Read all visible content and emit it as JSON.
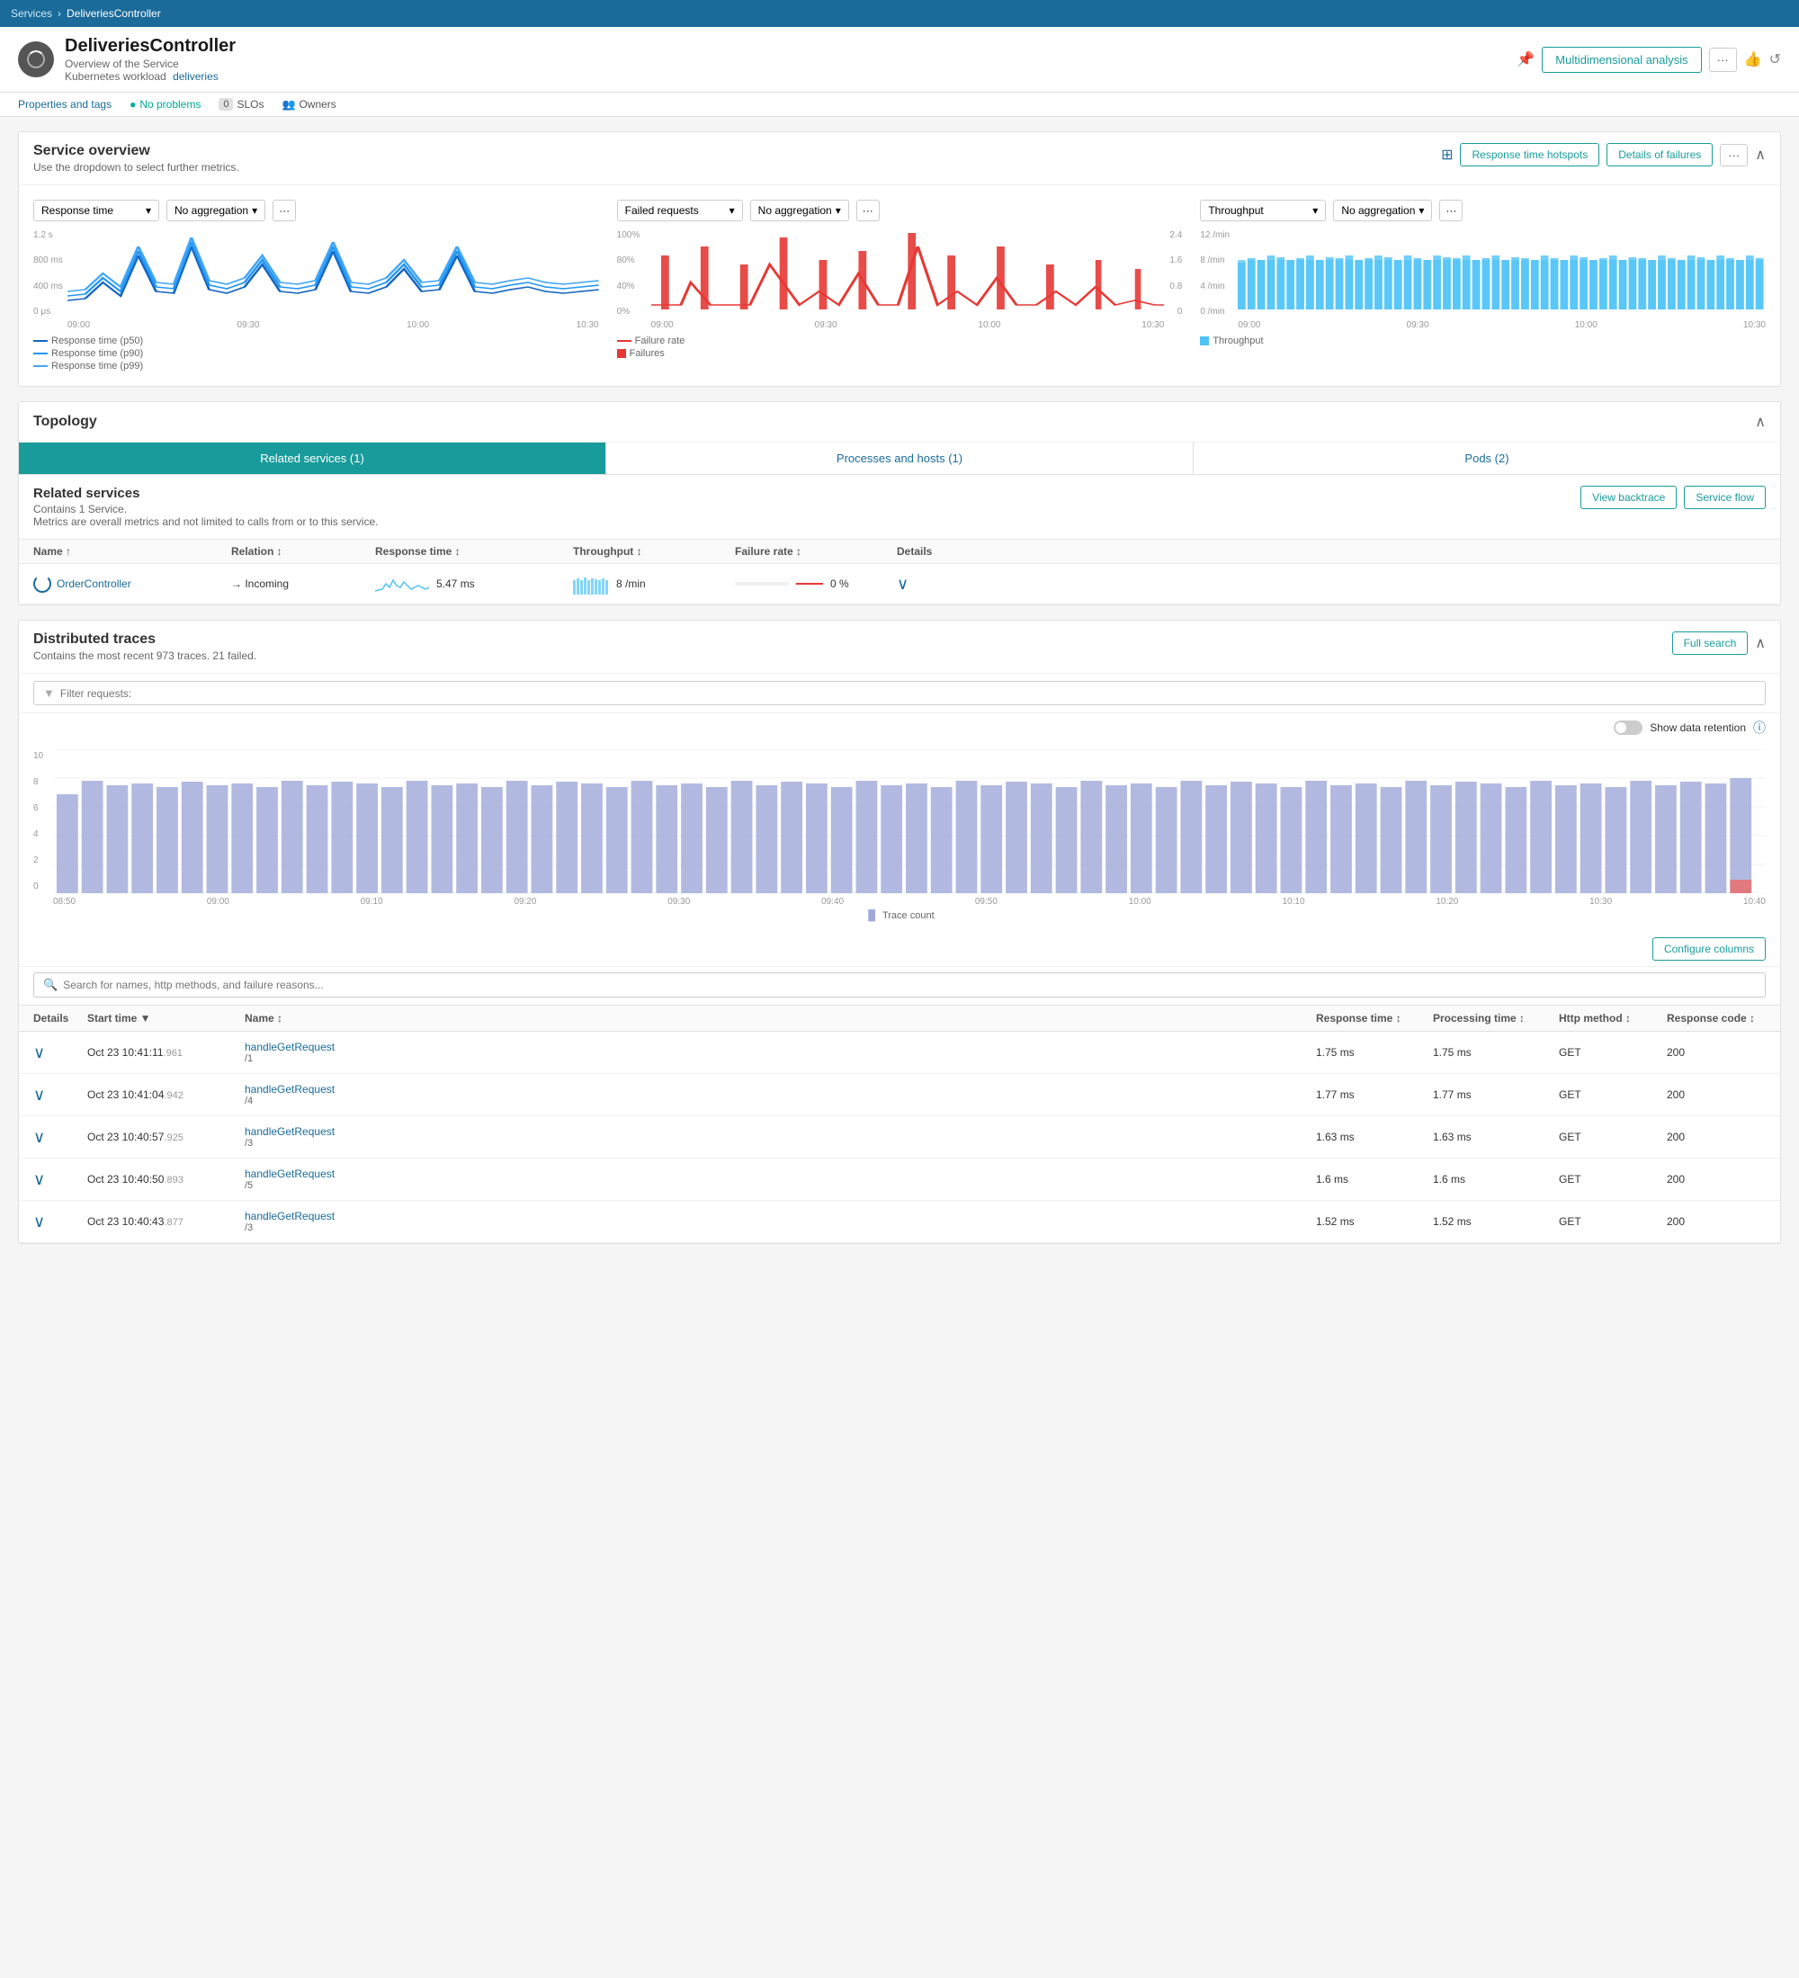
{
  "nav": {
    "items": [
      "Services",
      "DeliveriesController"
    ],
    "separator": "›"
  },
  "header": {
    "title": "DeliveriesController",
    "subtitle_line1": "Overview of the Service",
    "subtitle_line2": "Kubernetes workload",
    "workload_link": "deliveries",
    "btn_multidimensional": "Multidimensional analysis",
    "btn_more": "···",
    "btn_pin": "📌",
    "btn_refresh": "↺"
  },
  "subheader": {
    "properties_tags": "Properties and tags",
    "no_problems": "No problems",
    "slos_badge": "0",
    "slos_label": "SLOs",
    "owners_label": "Owners"
  },
  "service_overview": {
    "title": "Service overview",
    "subtitle": "Use the dropdown to select further metrics.",
    "btn_response_hotspots": "Response time hotspots",
    "btn_details_failures": "Details of failures",
    "btn_more": "···",
    "chart1": {
      "metric_label": "Response time",
      "aggregation_label": "No aggregation",
      "y_labels": [
        "1.2 s",
        "800 ms",
        "400 ms",
        "0 μs"
      ],
      "x_labels": [
        "09:00",
        "09:30",
        "10:00",
        "10:30"
      ],
      "legend": [
        {
          "label": "Response time (p50)",
          "color": "#1a6b9a"
        },
        {
          "label": "Response time (p90)",
          "color": "#1a6b9a"
        },
        {
          "label": "Response time (p99)",
          "color": "#1a6b9a"
        }
      ]
    },
    "chart2": {
      "metric_label": "Failed requests",
      "aggregation_label": "No aggregation",
      "y_labels": [
        "100 %",
        "80 %",
        "40 %",
        "0 %"
      ],
      "y2_labels": [
        "2.4",
        "1.6",
        "0.8",
        "0"
      ],
      "x_labels": [
        "09:00",
        "09:30",
        "10:00",
        "10:30"
      ],
      "legend": [
        {
          "label": "Failure rate",
          "color": "#e53935"
        },
        {
          "label": "Failures",
          "color": "#e53935"
        }
      ]
    },
    "chart3": {
      "metric_label": "Throughput",
      "aggregation_label": "No aggregation",
      "y_labels": [
        "12 /min",
        "8 /min",
        "4 /min",
        "0 /min"
      ],
      "x_labels": [
        "09:00",
        "09:30",
        "10:00",
        "10:30"
      ],
      "legend": [
        {
          "label": "Throughput",
          "color": "#64b5f6"
        }
      ]
    }
  },
  "topology": {
    "title": "Topology",
    "tabs": [
      {
        "label": "Related services (1)",
        "active": true
      },
      {
        "label": "Processes and hosts (1)",
        "active": false
      },
      {
        "label": "Pods (2)",
        "active": false
      }
    ],
    "related_title": "Related services",
    "related_subtitle1": "Contains 1 Service.",
    "related_subtitle2": "Metrics are overall metrics and not limited to calls from or to this service.",
    "btn_view_backtrace": "View backtrace",
    "btn_service_flow": "Service flow",
    "table_headers": [
      "Name",
      "Relation",
      "Response time",
      "Throughput",
      "Failure rate",
      "Details"
    ],
    "rows": [
      {
        "name": "OrderController",
        "relation": "→ Incoming",
        "response_time": "5.47 ms",
        "throughput": "8 /min",
        "failure_rate": "0 %"
      }
    ]
  },
  "distributed_traces": {
    "title": "Distributed traces",
    "subtitle": "Contains the most recent 973 traces. 21 failed.",
    "btn_full_search": "Full search",
    "filter_placeholder": "Filter requests:",
    "toggle_label": "Show data retention",
    "search_placeholder": "Search for names, http methods, and failure reasons...",
    "btn_configure": "Configure columns",
    "x_labels": [
      "08:50",
      "09:00",
      "09:10",
      "09:20",
      "09:30",
      "09:40",
      "09:50",
      "10:00",
      "10:10",
      "10:20",
      "10:30",
      "10:40"
    ],
    "y_labels": [
      "10",
      "8",
      "6",
      "4",
      "2",
      "0"
    ],
    "trace_count_label": "Trace count",
    "table_headers": [
      "Details",
      "Start time ▼",
      "Name",
      "Response time",
      "Processing time",
      "Http method",
      "Response code"
    ],
    "rows": [
      {
        "start_time": "Oct 23 10:41:11",
        "start_ms": ".961",
        "name_main": "handleGetRequest",
        "name_sub": "/1",
        "response_time": "1.75 ms",
        "processing_time": "1.75 ms",
        "http_method": "GET",
        "response_code": "200"
      },
      {
        "start_time": "Oct 23 10:41:04",
        "start_ms": ".942",
        "name_main": "handleGetRequest",
        "name_sub": "/4",
        "response_time": "1.77 ms",
        "processing_time": "1.77 ms",
        "http_method": "GET",
        "response_code": "200"
      },
      {
        "start_time": "Oct 23 10:40:57",
        "start_ms": ".925",
        "name_main": "handleGetRequest",
        "name_sub": "/3",
        "response_time": "1.63 ms",
        "processing_time": "1.63 ms",
        "http_method": "GET",
        "response_code": "200"
      },
      {
        "start_time": "Oct 23 10:40:50",
        "start_ms": ".893",
        "name_main": "handleGetRequest",
        "name_sub": "/5",
        "response_time": "1.6 ms",
        "processing_time": "1.6 ms",
        "http_method": "GET",
        "response_code": "200"
      },
      {
        "start_time": "Oct 23 10:40:43",
        "start_ms": ".877",
        "name_main": "handleGetRequest",
        "name_sub": "/3",
        "response_time": "1.52 ms",
        "processing_time": "1.52 ms",
        "http_method": "GET",
        "response_code": "200"
      }
    ]
  }
}
